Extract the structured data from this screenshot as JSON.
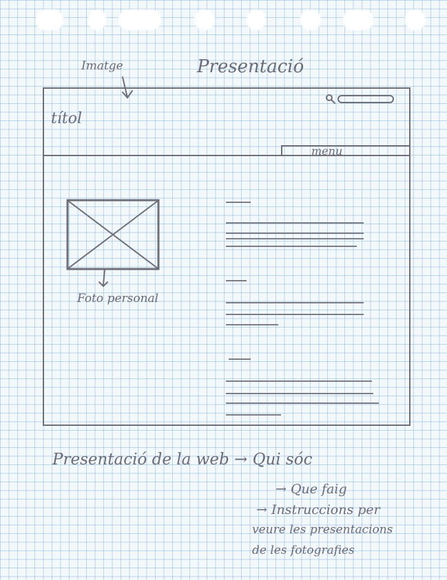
{
  "sketch": {
    "page_title": "Presentació",
    "header_annotation": "Imatge",
    "site_title": "títol",
    "menu_label": "menu",
    "photo_label": "Foto personal",
    "footer_lines": [
      "Presentació de la web → Qui sóc",
      "→ Que faig",
      "→ Instruccions per",
      "veure les presentacions",
      "de les fotografies"
    ]
  },
  "icons": {
    "search": "search-icon",
    "placeholder_image": "image-placeholder-icon",
    "arrow": "arrow-icon"
  },
  "colors": {
    "pencil": "#6f6f7a",
    "grid": "#78aad2",
    "paper": "#f3f8fb"
  }
}
